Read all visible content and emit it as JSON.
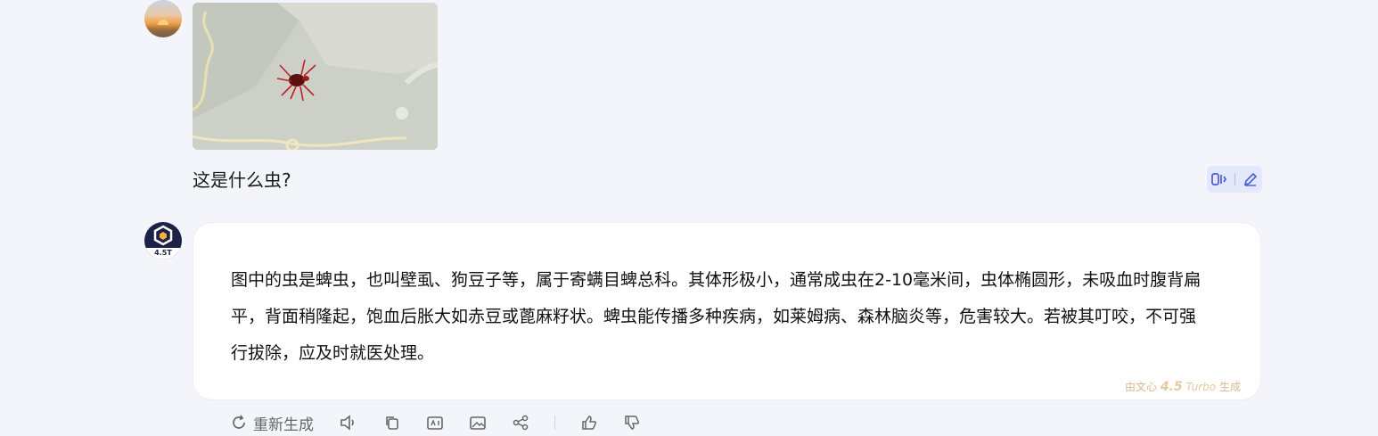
{
  "conversation": {
    "user_message": {
      "avatar": "sunset-avatar",
      "image_alt": "tick-photo",
      "text": "这是什么虫?",
      "actions": [
        {
          "icon": "compare-icon"
        },
        {
          "icon": "edit-icon"
        }
      ]
    },
    "bot_message": {
      "avatar_badge": "4.5T",
      "text": "图中的虫是蜱虫，也叫壁虱、狗豆子等，属于寄螨目蜱总科。其体形极小，通常成虫在2-10毫米间，虫体椭圆形，未吸血时腹背扁平，背面稍隆起，饱血后胀大如赤豆或蓖麻籽状。蜱虫能传播多种疾病，如莱姆病、森林脑炎等，危害较大。若被其叮咬，不可强行拔除，应及时就医处理。",
      "generated_by": {
        "prefix": "由文心",
        "version": "4.5",
        "model": "Turbo",
        "suffix": "生成"
      }
    },
    "toolbar": {
      "regenerate_label": "重新生成",
      "icons": [
        "speaker-icon",
        "copy-icon",
        "ai-icon",
        "image-icon",
        "share-icon",
        "thumbs-up-icon",
        "thumbs-down-icon"
      ]
    }
  },
  "colors": {
    "background": "#f4f5fb",
    "card": "#ffffff",
    "accent": "#4a5bd6",
    "bot_avatar": "#1d2148",
    "watermark": "#d8b98f"
  }
}
